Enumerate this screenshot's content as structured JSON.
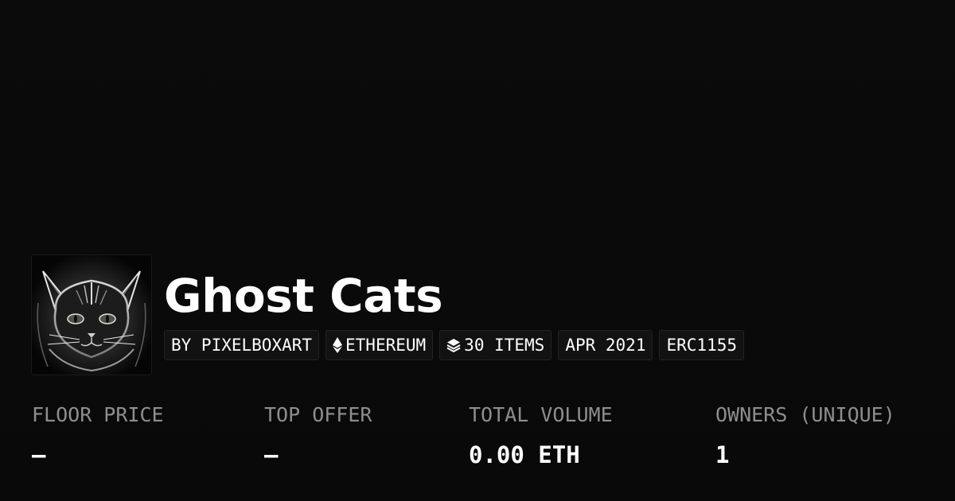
{
  "collection": {
    "name": "Ghost Cats",
    "avatar_icon": "ghost-cat-avatar"
  },
  "tags": {
    "creator": "BY PIXELBOXART",
    "chain": "ETHEREUM",
    "chain_icon": "ethereum-icon",
    "items": "30 ITEMS",
    "items_icon": "layers-icon",
    "date": "APR 2021",
    "standard": "ERC1155"
  },
  "stats": [
    {
      "label": "FLOOR PRICE",
      "value": "–"
    },
    {
      "label": "TOP OFFER",
      "value": "–"
    },
    {
      "label": "TOTAL VOLUME",
      "value": "0.00 ETH"
    },
    {
      "label": "OWNERS (UNIQUE)",
      "value": "1"
    }
  ],
  "colors": {
    "background": "#0a0a0a",
    "tag_background": "#121212",
    "tag_border": "#222222",
    "label": "#8e8e8e",
    "text": "#ffffff"
  }
}
